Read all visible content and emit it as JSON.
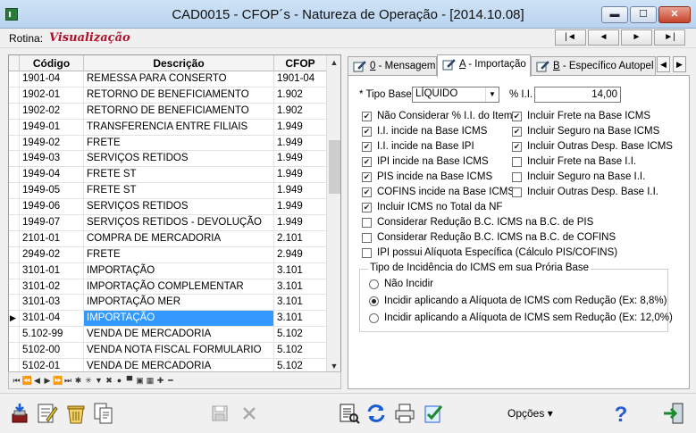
{
  "window": {
    "title": "CAD0015 - CFOP´s - Natureza de Operação - [2014.10.08]",
    "min_label": "▬",
    "max_label": "☐",
    "close_label": "✕"
  },
  "rotina": {
    "label": "Rotina:",
    "value": "Visualização"
  },
  "nav_buttons": [
    "|◄",
    "◄",
    "►",
    "►|"
  ],
  "grid": {
    "columns": [
      "Código",
      "Descrição",
      "CFOP"
    ],
    "rows": [
      {
        "codigo": "1901-04",
        "descricao": "REMESSA PARA CONSERTO",
        "cfop": "1901-04",
        "selected": false
      },
      {
        "codigo": "1902-01",
        "descricao": "RETORNO DE BENEFICIAMENTO",
        "cfop": "1.902",
        "selected": false
      },
      {
        "codigo": "1902-02",
        "descricao": "RETORNO DE BENEFICIAMENTO",
        "cfop": "1.902",
        "selected": false
      },
      {
        "codigo": "1949-01",
        "descricao": "TRANSFERENCIA ENTRE FILIAIS",
        "cfop": "1.949",
        "selected": false
      },
      {
        "codigo": "1949-02",
        "descricao": "FRETE",
        "cfop": "1.949",
        "selected": false
      },
      {
        "codigo": "1949-03",
        "descricao": "SERVIÇOS RETIDOS",
        "cfop": "1.949",
        "selected": false
      },
      {
        "codigo": "1949-04",
        "descricao": "FRETE ST",
        "cfop": "1.949",
        "selected": false
      },
      {
        "codigo": "1949-05",
        "descricao": "FRETE ST",
        "cfop": "1.949",
        "selected": false
      },
      {
        "codigo": "1949-06",
        "descricao": "SERVIÇOS RETIDOS",
        "cfop": "1.949",
        "selected": false
      },
      {
        "codigo": "1949-07",
        "descricao": "SERVIÇOS RETIDOS - DEVOLUÇÃO",
        "cfop": "1.949",
        "selected": false
      },
      {
        "codigo": "2101-01",
        "descricao": "COMPRA DE MERCADORIA",
        "cfop": "2.101",
        "selected": false
      },
      {
        "codigo": "2949-02",
        "descricao": "FRETE",
        "cfop": "2.949",
        "selected": false
      },
      {
        "codigo": "3101-01",
        "descricao": "IMPORTAÇÃO",
        "cfop": "3.101",
        "selected": false
      },
      {
        "codigo": "3101-02",
        "descricao": "IMPORTAÇÃO COMPLEMENTAR",
        "cfop": "3.101",
        "selected": false
      },
      {
        "codigo": "3101-03",
        "descricao": "IMPORTAÇÃO MER",
        "cfop": "3.101",
        "selected": false
      },
      {
        "codigo": "3101-04",
        "descricao": "IMPORTAÇÃO",
        "cfop": "3.101",
        "selected": true
      },
      {
        "codigo": "5.102-99",
        "descricao": "VENDA DE MERCADORIA",
        "cfop": "5.102",
        "selected": false
      },
      {
        "codigo": "5102-00",
        "descricao": "VENDA NOTA FISCAL FORMULARIO",
        "cfop": "5.102",
        "selected": false
      },
      {
        "codigo": "5102-01",
        "descricao": "VENDA DE MERCADORIA",
        "cfop": "5.102",
        "selected": false
      }
    ],
    "row_indicator": "▶"
  },
  "grid_nav_glyphs": [
    "⏮",
    "⏪",
    "◀",
    "▶",
    "⏩",
    "⏭",
    "✱",
    "✳",
    "▼",
    "✖",
    "●",
    "▀",
    "▣",
    "▦",
    "✚",
    "━"
  ],
  "tabs": [
    {
      "key": "0",
      "label": " - Mensagem",
      "active": false
    },
    {
      "key": "A",
      "label": " - Importação",
      "active": true
    },
    {
      "key": "B",
      "label": " - Específico Autopel",
      "active": false
    }
  ],
  "importacao": {
    "tipo_base_label": "* Tipo Base",
    "tipo_base_value": "LÍQUIDO",
    "ii_label": "% I.I.",
    "ii_value": "14,00",
    "checks_left": [
      {
        "label": "Não Considerar % I.I. do Item",
        "checked": true
      },
      {
        "label": "I.I. incide na Base ICMS",
        "checked": true
      },
      {
        "label": "I.I. incide na Base IPI",
        "checked": true
      },
      {
        "label": "IPI incide na Base ICMS",
        "checked": true
      },
      {
        "label": "PIS incide na Base ICMS",
        "checked": true
      },
      {
        "label": "COFINS incide na Base ICMS",
        "checked": true
      },
      {
        "label": "Incluir ICMS no Total da NF",
        "checked": true
      },
      {
        "label": "Considerar Redução B.C. ICMS na B.C. de PIS",
        "checked": false
      },
      {
        "label": "Considerar Redução B.C. ICMS na B.C. de COFINS",
        "checked": false
      },
      {
        "label": "IPI possui Alíquota Específica (Cálculo PIS/COFINS)",
        "checked": false
      }
    ],
    "checks_right": [
      {
        "label": "Incluir Frete na Base ICMS",
        "checked": true
      },
      {
        "label": "Incluir Seguro na Base ICMS",
        "checked": true
      },
      {
        "label": "Incluir Outras Desp. Base ICMS",
        "checked": true
      },
      {
        "label": "Incluir Frete na Base I.I.",
        "checked": false
      },
      {
        "label": "Incluir Seguro na Base I.I.",
        "checked": false
      },
      {
        "label": "Incluir Outras Desp. Base I.I.",
        "checked": false
      }
    ],
    "group_title": "Tipo de Incidência do ICMS em sua Prória Base",
    "radios": [
      {
        "label": "Não Incidir",
        "checked": false
      },
      {
        "label": "Incidir aplicando a Alíquota de ICMS com Redução (Ex: 8,8%)",
        "checked": true
      },
      {
        "label": "Incidir aplicando a Alíquota de ICMS sem Redução (Ex: 12,0%)",
        "checked": false
      }
    ]
  },
  "toolbar": {
    "opcoes_label": "Opções ▾",
    "colors": {
      "accent": "#3399ff",
      "rotina": "#b0102a",
      "help": "#2a5bd7"
    }
  }
}
